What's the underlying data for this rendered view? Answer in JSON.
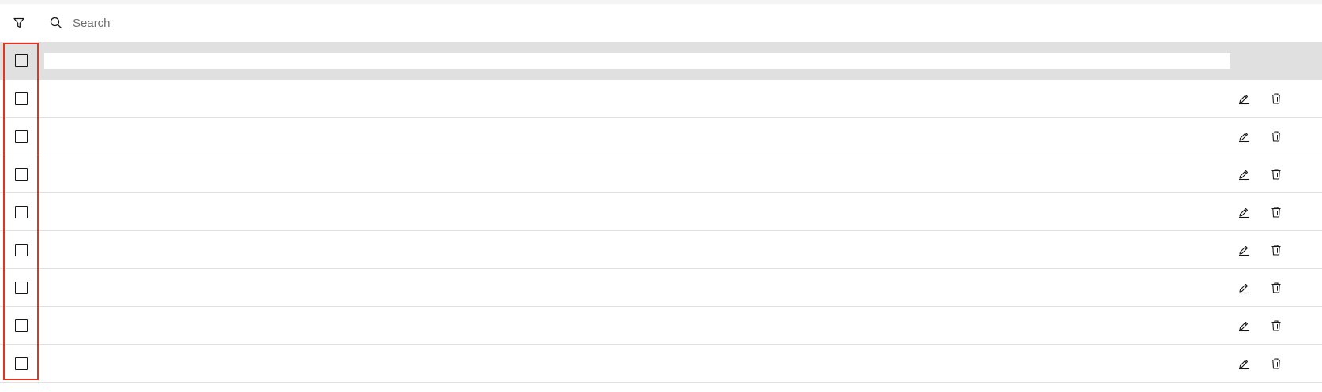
{
  "toolbar": {
    "filter_icon": "filter-icon",
    "search_icon": "search-icon",
    "search_placeholder": "Search",
    "search_value": ""
  },
  "table": {
    "header": {
      "select_all_checked": false,
      "header_text": ""
    },
    "rows": [
      {
        "checked": false,
        "text": "",
        "edit_icon": "edit-icon",
        "delete_icon": "trash-icon"
      },
      {
        "checked": false,
        "text": "",
        "edit_icon": "edit-icon",
        "delete_icon": "trash-icon"
      },
      {
        "checked": false,
        "text": "",
        "edit_icon": "edit-icon",
        "delete_icon": "trash-icon"
      },
      {
        "checked": false,
        "text": "",
        "edit_icon": "edit-icon",
        "delete_icon": "trash-icon"
      },
      {
        "checked": false,
        "text": "",
        "edit_icon": "edit-icon",
        "delete_icon": "trash-icon"
      },
      {
        "checked": false,
        "text": "",
        "edit_icon": "edit-icon",
        "delete_icon": "trash-icon"
      },
      {
        "checked": false,
        "text": "",
        "edit_icon": "edit-icon",
        "delete_icon": "trash-icon"
      },
      {
        "checked": false,
        "text": "",
        "edit_icon": "edit-icon",
        "delete_icon": "trash-icon"
      }
    ]
  },
  "colors": {
    "header_background": "#e0e0e0",
    "row_divider": "#e0e0e0",
    "highlight_outline": "#e2341f",
    "icon_color": "#161616"
  }
}
